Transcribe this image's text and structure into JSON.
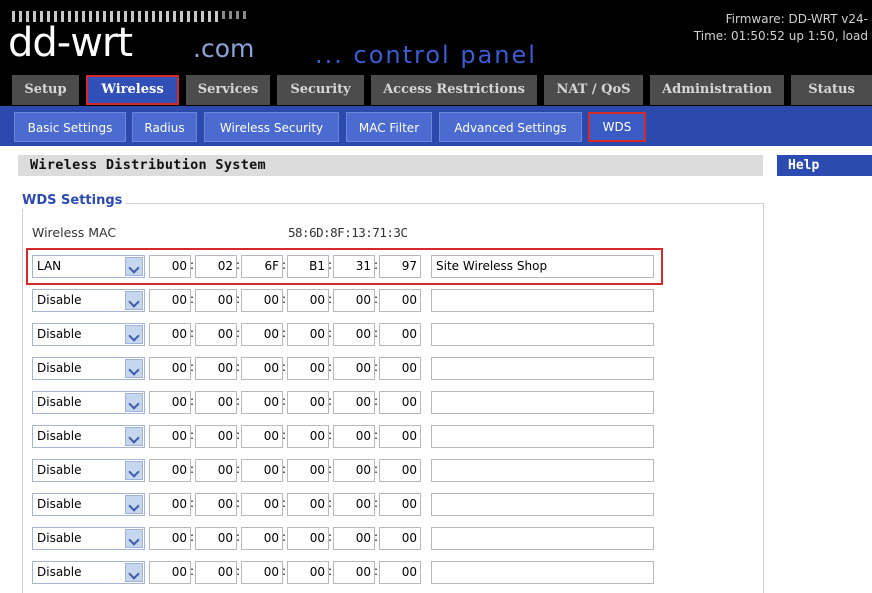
{
  "header": {
    "logo_text": "dd-wrt",
    "logo_domain": ".com",
    "logo_subtitle": "... control panel",
    "firmware": "Firmware: DD-WRT v24-",
    "time": "Time: 01:50:52 up 1:50, load"
  },
  "main_tabs": [
    {
      "label": "Setup",
      "active": false
    },
    {
      "label": "Wireless",
      "active": true
    },
    {
      "label": "Services",
      "active": false
    },
    {
      "label": "Security",
      "active": false
    },
    {
      "label": "Access Restrictions",
      "active": false
    },
    {
      "label": "NAT / QoS",
      "active": false
    },
    {
      "label": "Administration",
      "active": false
    },
    {
      "label": "Status",
      "active": false
    }
  ],
  "sub_tabs": [
    {
      "label": "Basic Settings",
      "active": false
    },
    {
      "label": "Radius",
      "active": false
    },
    {
      "label": "Wireless Security",
      "active": false
    },
    {
      "label": "MAC Filter",
      "active": false
    },
    {
      "label": "Advanced Settings",
      "active": false
    },
    {
      "label": "WDS",
      "active": true
    }
  ],
  "section_title": "Wireless Distribution System",
  "help_title": "Help",
  "wds_settings": {
    "legend": "WDS Settings",
    "wireless_mac_label": "Wireless MAC",
    "wireless_mac_value": "58:6D:8F:13:71:3C",
    "rows": [
      {
        "mode": "LAN",
        "mac": [
          "00",
          "02",
          "6F",
          "B1",
          "31",
          "97"
        ],
        "description": "Site Wireless Shop",
        "highlighted": true
      },
      {
        "mode": "Disable",
        "mac": [
          "00",
          "00",
          "00",
          "00",
          "00",
          "00"
        ],
        "description": ""
      },
      {
        "mode": "Disable",
        "mac": [
          "00",
          "00",
          "00",
          "00",
          "00",
          "00"
        ],
        "description": ""
      },
      {
        "mode": "Disable",
        "mac": [
          "00",
          "00",
          "00",
          "00",
          "00",
          "00"
        ],
        "description": ""
      },
      {
        "mode": "Disable",
        "mac": [
          "00",
          "00",
          "00",
          "00",
          "00",
          "00"
        ],
        "description": ""
      },
      {
        "mode": "Disable",
        "mac": [
          "00",
          "00",
          "00",
          "00",
          "00",
          "00"
        ],
        "description": ""
      },
      {
        "mode": "Disable",
        "mac": [
          "00",
          "00",
          "00",
          "00",
          "00",
          "00"
        ],
        "description": ""
      },
      {
        "mode": "Disable",
        "mac": [
          "00",
          "00",
          "00",
          "00",
          "00",
          "00"
        ],
        "description": ""
      },
      {
        "mode": "Disable",
        "mac": [
          "00",
          "00",
          "00",
          "00",
          "00",
          "00"
        ],
        "description": ""
      },
      {
        "mode": "Disable",
        "mac": [
          "00",
          "00",
          "00",
          "00",
          "00",
          "00"
        ],
        "description": ""
      }
    ]
  },
  "colors": {
    "header_bg": "#000000",
    "tab_bg": "#4c4c4c",
    "active_tab_bg": "#3050b8",
    "subtab_bar_bg": "#2c4aad",
    "highlight_border": "#d42a2a",
    "legend_color": "#2b4bb0"
  }
}
